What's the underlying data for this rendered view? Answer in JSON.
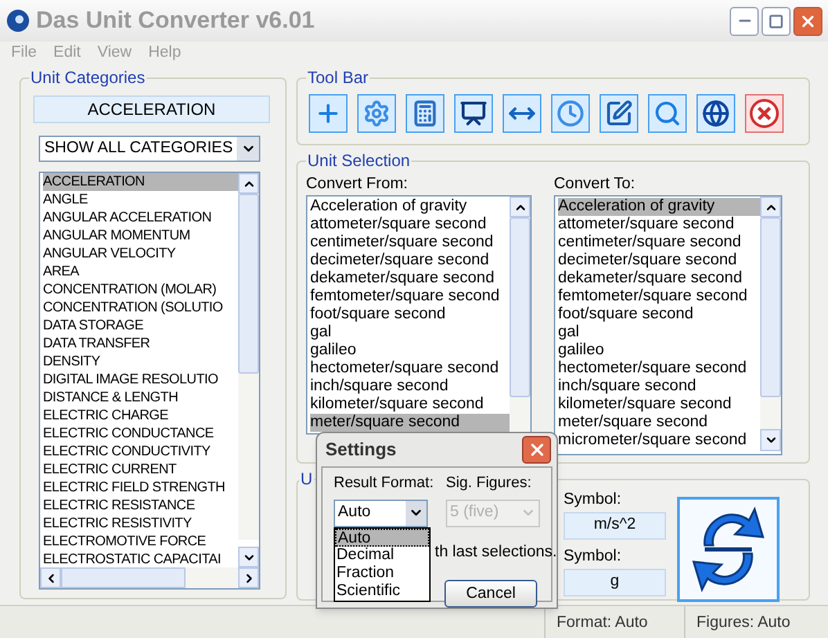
{
  "window": {
    "title": "Das Unit Converter v6.01"
  },
  "menu": [
    "File",
    "Edit",
    "View",
    "Help"
  ],
  "unit_categories": {
    "label": "Unit Categories",
    "current": "ACCELERATION",
    "filter": {
      "value": "SHOW ALL CATEGORIES"
    },
    "items": [
      {
        "label": "ACCELERATION",
        "selected": true
      },
      {
        "label": "ANGLE",
        "selected": false
      },
      {
        "label": "ANGULAR ACCELERATION",
        "selected": false
      },
      {
        "label": "ANGULAR MOMENTUM",
        "selected": false
      },
      {
        "label": "ANGULAR VELOCITY",
        "selected": false
      },
      {
        "label": "AREA",
        "selected": false
      },
      {
        "label": "CONCENTRATION (MOLAR)",
        "selected": false
      },
      {
        "label": "CONCENTRATION (SOLUTIO",
        "selected": false
      },
      {
        "label": "DATA STORAGE",
        "selected": false
      },
      {
        "label": "DATA TRANSFER",
        "selected": false
      },
      {
        "label": "DENSITY",
        "selected": false
      },
      {
        "label": "DIGITAL IMAGE RESOLUTIO",
        "selected": false
      },
      {
        "label": "DISTANCE & LENGTH",
        "selected": false
      },
      {
        "label": "ELECTRIC CHARGE",
        "selected": false
      },
      {
        "label": "ELECTRIC CONDUCTANCE",
        "selected": false
      },
      {
        "label": "ELECTRIC CONDUCTIVITY",
        "selected": false
      },
      {
        "label": "ELECTRIC CURRENT",
        "selected": false
      },
      {
        "label": "ELECTRIC FIELD STRENGTH",
        "selected": false
      },
      {
        "label": "ELECTRIC RESISTANCE",
        "selected": false
      },
      {
        "label": "ELECTRIC RESISTIVITY",
        "selected": false
      },
      {
        "label": "ELECTROMOTIVE FORCE",
        "selected": false
      },
      {
        "label": "ELECTROSTATIC CAPACITAI",
        "selected": false
      }
    ]
  },
  "toolbar": {
    "label": "Tool Bar"
  },
  "unit_selection": {
    "label": "Unit Selection",
    "from": {
      "label": "Convert From:",
      "items": [
        {
          "label": "Acceleration of gravity",
          "selected": false
        },
        {
          "label": "attometer/square second",
          "selected": false
        },
        {
          "label": "centimeter/square second",
          "selected": false
        },
        {
          "label": "decimeter/square second",
          "selected": false
        },
        {
          "label": "dekameter/square second",
          "selected": false
        },
        {
          "label": "femtometer/square second",
          "selected": false
        },
        {
          "label": "foot/square second",
          "selected": false
        },
        {
          "label": "gal",
          "selected": false
        },
        {
          "label": "galileo",
          "selected": false
        },
        {
          "label": "hectometer/square second",
          "selected": false
        },
        {
          "label": "inch/square second",
          "selected": false
        },
        {
          "label": "kilometer/square second",
          "selected": false
        },
        {
          "label": "meter/square second",
          "selected": true
        }
      ]
    },
    "to": {
      "label": "Convert To:",
      "items": [
        {
          "label": "Acceleration of gravity",
          "selected": true
        },
        {
          "label": "attometer/square second",
          "selected": false
        },
        {
          "label": "centimeter/square second",
          "selected": false
        },
        {
          "label": "decimeter/square second",
          "selected": false
        },
        {
          "label": "dekameter/square second",
          "selected": false
        },
        {
          "label": "femtometer/square second",
          "selected": false
        },
        {
          "label": "foot/square second",
          "selected": false
        },
        {
          "label": "gal",
          "selected": false
        },
        {
          "label": "galileo",
          "selected": false
        },
        {
          "label": "hectometer/square second",
          "selected": false
        },
        {
          "label": "inch/square second",
          "selected": false
        },
        {
          "label": "kilometer/square second",
          "selected": false
        },
        {
          "label": "meter/square second",
          "selected": false
        },
        {
          "label": "micrometer/square second",
          "selected": false
        }
      ]
    }
  },
  "result_group": {
    "label": "U",
    "symbols": [
      {
        "label": "Symbol:",
        "value": "m/s^2"
      },
      {
        "label": "Symbol:",
        "value": "g"
      }
    ]
  },
  "settings": {
    "title": "Settings",
    "result_format": {
      "label": "Result Format:",
      "value": "Auto",
      "options": [
        {
          "label": "Auto",
          "selected": true
        },
        {
          "label": "Decimal",
          "selected": false
        },
        {
          "label": "Fraction",
          "selected": false
        },
        {
          "label": "Scientific",
          "selected": false
        }
      ]
    },
    "sig_figures": {
      "label": "Sig. Figures:",
      "value": "5 (five)",
      "disabled": true
    },
    "note": "th last selections.",
    "cancel": "Cancel"
  },
  "status_bar": [
    "Format: Auto",
    "Figures: Auto"
  ]
}
